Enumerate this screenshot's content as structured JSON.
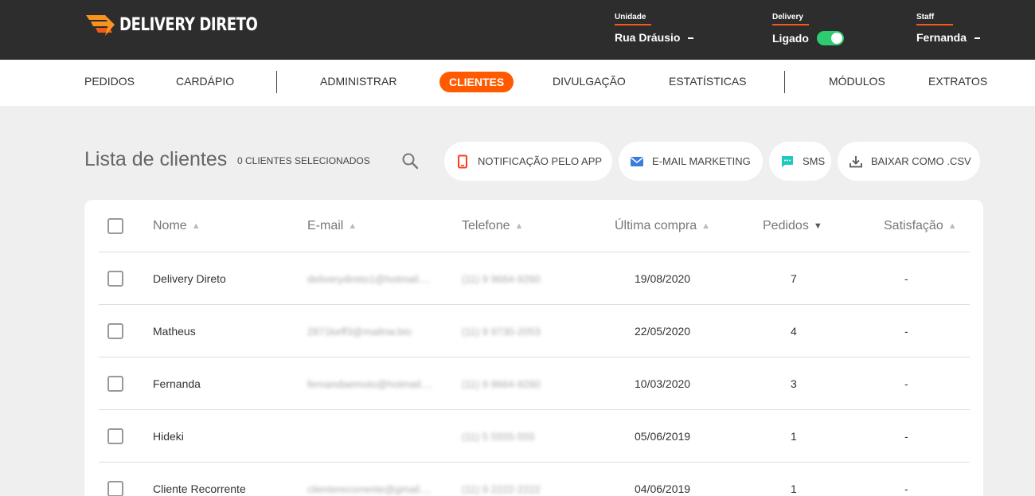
{
  "brand": {
    "name": "DELIVERY DIRETO"
  },
  "top": {
    "unidade": {
      "label": "Unidade",
      "value": "Rua Dráusio"
    },
    "delivery": {
      "label": "Delivery",
      "value": "Ligado",
      "toggle_on": true
    },
    "staff": {
      "label": "Staff",
      "value": "Fernanda"
    }
  },
  "nav": {
    "items": [
      "PEDIDOS",
      "CARDÁPIO",
      "ADMINISTRAR",
      "CLIENTES",
      "DIVULGAÇÃO",
      "ESTATÍSTICAS",
      "MÓDULOS",
      "EXTRATOS"
    ],
    "active": "CLIENTES"
  },
  "page": {
    "title": "Lista de clientes",
    "selected_count": "0 CLIENTES SELECIONADOS"
  },
  "actions": [
    "NOTIFICAÇÃO PELO APP",
    "E-MAIL MARKETING",
    "SMS",
    "BAIXAR COMO .CSV"
  ],
  "table": {
    "headers": [
      "Nome",
      "E-mail",
      "Telefone",
      "Última compra",
      "Pedidos",
      "Satisfação"
    ],
    "rows": [
      {
        "nome": "Delivery Direto",
        "email": "deliverydireto1@hotmail....",
        "telefone": "(11) 9 9664-9260",
        "ultima": "19/08/2020",
        "pedidos": "7",
        "satisfacao": "-"
      },
      {
        "nome": "Matheus",
        "email": "2871keff3@mailnw.bio",
        "telefone": "(11) 9 9730-2053",
        "ultima": "22/05/2020",
        "pedidos": "4",
        "satisfacao": "-"
      },
      {
        "nome": "Fernanda",
        "email": "fernandaemoto@hotmail....",
        "telefone": "(11) 9 9664-9260",
        "ultima": "10/03/2020",
        "pedidos": "3",
        "satisfacao": "-"
      },
      {
        "nome": "Hideki",
        "email": "",
        "telefone": "(11) 5 5555-555",
        "ultima": "05/06/2019",
        "pedidos": "1",
        "satisfacao": "-"
      },
      {
        "nome": "Cliente Recorrente",
        "email": "clienterecorrente@gmail....",
        "telefone": "(11) 9 2222-2222",
        "ultima": "04/06/2019",
        "pedidos": "1",
        "satisfacao": "-"
      }
    ]
  },
  "colors": {
    "accent": "#ff5a00",
    "topbar": "#2d2d2d",
    "toggle": "#2ecc71",
    "background": "#efefef"
  }
}
